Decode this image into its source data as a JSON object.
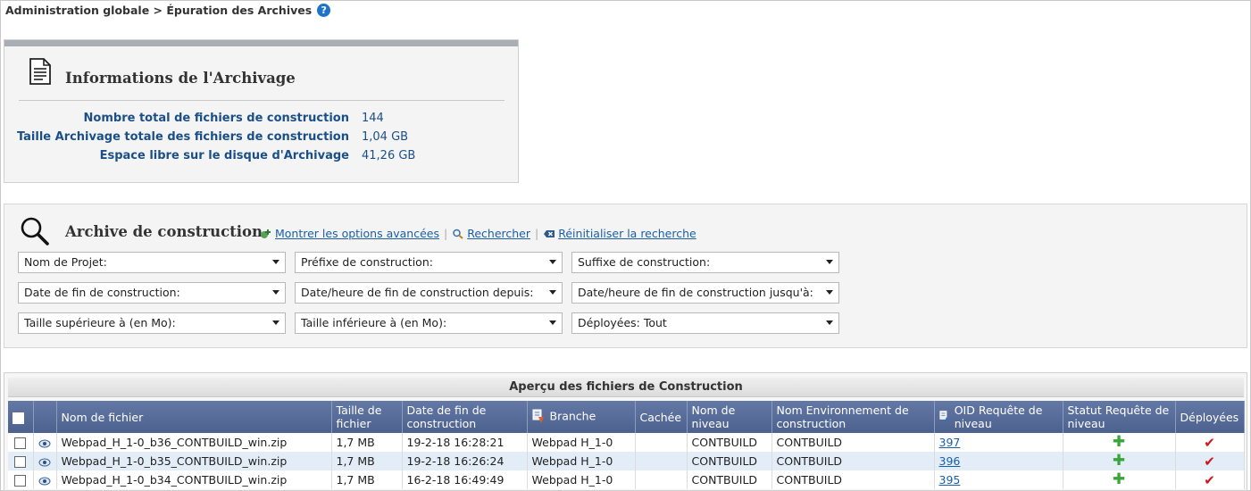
{
  "breadcrumb": "Administration globale > Épuration des Archives",
  "info": {
    "title": "Informations de l'Archivage",
    "rows": [
      {
        "label": "Nombre total de fichiers de construction",
        "value": "144"
      },
      {
        "label": "Taille Archivage totale des fichiers de construction",
        "value": "1,04 GB"
      },
      {
        "label": "Espace libre sur le disque d'Archivage",
        "value": "41,26 GB"
      }
    ]
  },
  "search": {
    "title": "Archive de construction",
    "links": {
      "advanced": "Montrer les options avancées",
      "search": "Rechercher",
      "reset": "Réinitialiser la recherche"
    },
    "filters": [
      "Nom de Projet:",
      "Préfixe de construction:",
      "Suffixe de construction:",
      "Date de fin de construction:",
      "Date/heure de fin de construction depuis:",
      "Date/heure de fin de construction jusqu'à:",
      "Taille supérieure à (en Mo):",
      "Taille inférieure à (en Mo):",
      "Déployées: Tout"
    ]
  },
  "table": {
    "caption": "Aperçu des fichiers de Construction",
    "headers": {
      "filename": "Nom de fichier",
      "size": "Taille de fichier",
      "enddate": "Date de fin de construction",
      "branch": "Branche",
      "hidden": "Cachée",
      "level": "Nom de niveau",
      "env": "Nom Environnement de construction",
      "oid": "OID Requête de niveau",
      "status": "Statut Requête de niveau",
      "deployed": "Déployées"
    },
    "rows": [
      {
        "filename": "Webpad_H_1-0_b36_CONTBUILD_win.zip",
        "size": "1,7 MB",
        "enddate": "19-2-18 16:28:21",
        "branch": "Webpad H_1-0",
        "hidden": "",
        "level": "CONTBUILD",
        "env": "CONTBUILD",
        "oid": "397"
      },
      {
        "filename": "Webpad_H_1-0_b35_CONTBUILD_win.zip",
        "size": "1,7 MB",
        "enddate": "19-2-18 16:26:24",
        "branch": "Webpad H_1-0",
        "hidden": "",
        "level": "CONTBUILD",
        "env": "CONTBUILD",
        "oid": "396"
      },
      {
        "filename": "Webpad_H_1-0_b34_CONTBUILD_win.zip",
        "size": "1,7 MB",
        "enddate": "16-2-18 16:49:49",
        "branch": "Webpad H_1-0",
        "hidden": "",
        "level": "CONTBUILD",
        "env": "CONTBUILD",
        "oid": "395"
      }
    ]
  },
  "colors": {
    "accent": "#1a5fa8",
    "label_blue": "#1b4f87",
    "header_blue": "#56699a",
    "row_alt": "#e3edf8"
  }
}
